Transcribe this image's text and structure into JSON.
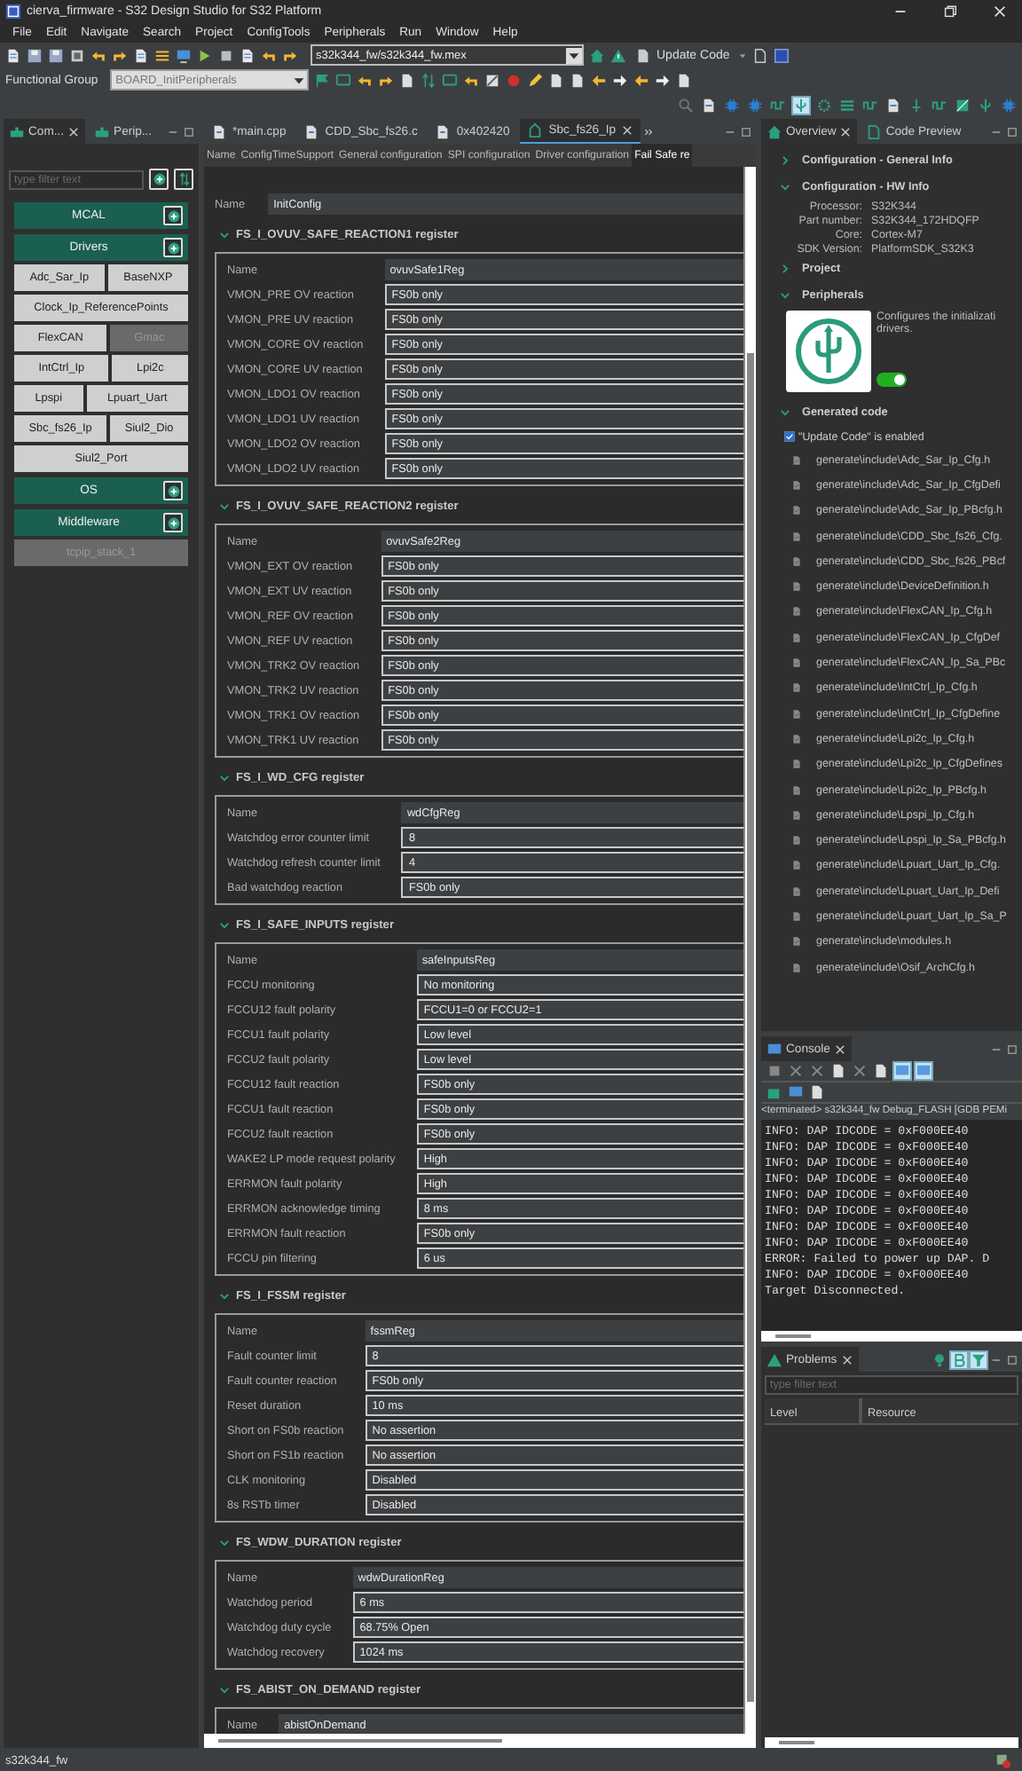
{
  "window": {
    "title": "cierva_firmware - S32 Design Studio for S32 Platform"
  },
  "menu": [
    "File",
    "Edit",
    "Navigate",
    "Search",
    "Project",
    "ConfigTools",
    "Peripherals",
    "Run",
    "Window",
    "Help"
  ],
  "toolbar": {
    "config_file": "s32k344_fw/s32k344_fw.mex",
    "update_code": "Update Code",
    "functional_group_label": "Functional Group",
    "functional_group": {
      "value": "BOARD_InitPeripherals",
      "disabled": true
    }
  },
  "left_panel": {
    "tabs": [
      {
        "label": "Com...",
        "selected": true
      },
      {
        "label": "Perip...",
        "selected": false
      }
    ],
    "filter_placeholder": "type filter text",
    "groups": [
      {
        "name": "MCAL"
      },
      {
        "name": "Drivers",
        "rows": [
          [
            {
              "name": "Adc_Sar_Ip",
              "disabled": false
            },
            {
              "name": "BaseNXP",
              "disabled": false
            }
          ],
          [
            {
              "name": "Clock_Ip_ReferencePoints",
              "disabled": false
            }
          ],
          [
            {
              "name": "FlexCAN",
              "disabled": false
            },
            {
              "name": "Gmac",
              "disabled": true
            }
          ],
          [
            {
              "name": "IntCtrl_Ip",
              "disabled": false
            },
            {
              "name": "Lpi2c",
              "disabled": false
            }
          ],
          [
            {
              "name": "Lpspi",
              "disabled": false
            },
            {
              "name": "Lpuart_Uart",
              "disabled": false
            }
          ],
          [
            {
              "name": "Sbc_fs26_Ip",
              "disabled": false
            },
            {
              "name": "Siul2_Dio",
              "disabled": false
            }
          ],
          [
            {
              "name": "Siul2_Port",
              "disabled": false
            }
          ]
        ]
      },
      {
        "name": "OS"
      },
      {
        "name": "Middleware",
        "rows": [
          [
            {
              "name": "tcpip_stack_1",
              "disabled": true
            }
          ]
        ]
      }
    ]
  },
  "editor": {
    "tabs": [
      {
        "label": "*main.cpp",
        "selected": false
      },
      {
        "label": "CDD_Sbc_fs26.c",
        "selected": false
      },
      {
        "label": "0x402420",
        "selected": false
      },
      {
        "label": "Sbc_fs26_Ip",
        "selected": true
      }
    ],
    "config_tabs": [
      {
        "label": "Name",
        "selected": false
      },
      {
        "label": "ConfigTimeSupport",
        "selected": false
      },
      {
        "label": "General configuration",
        "selected": false
      },
      {
        "label": "SPI configuration",
        "selected": false
      },
      {
        "label": "Driver configuration",
        "selected": false
      },
      {
        "label": "Fail Safe re",
        "selected": true
      }
    ],
    "name_field": {
      "label": "Name",
      "value": "InitConfig"
    },
    "sections": [
      {
        "title": "FS_I_OVUV_SAFE_REACTION1 register",
        "expanded": true,
        "fields": [
          {
            "label": "Name",
            "value": "ovuvSafe1Reg",
            "kind": "name"
          },
          {
            "label": "VMON_PRE OV reaction",
            "value": "FS0b only",
            "kind": "setting"
          },
          {
            "label": "VMON_PRE UV reaction",
            "value": "FS0b only",
            "kind": "setting"
          },
          {
            "label": "VMON_CORE OV reaction",
            "value": "FS0b only",
            "kind": "setting"
          },
          {
            "label": "VMON_CORE UV reaction",
            "value": "FS0b only",
            "kind": "setting"
          },
          {
            "label": "VMON_LDO1 OV reaction",
            "value": "FS0b only",
            "kind": "setting"
          },
          {
            "label": "VMON_LDO1 UV reaction",
            "value": "FS0b only",
            "kind": "setting"
          },
          {
            "label": "VMON_LDO2 OV reaction",
            "value": "FS0b only",
            "kind": "setting"
          },
          {
            "label": "VMON_LDO2 UV reaction",
            "value": "FS0b only",
            "kind": "setting"
          }
        ]
      },
      {
        "title": "FS_I_OVUV_SAFE_REACTION2 register",
        "expanded": true,
        "fields": [
          {
            "label": "Name",
            "value": "ovuvSafe2Reg",
            "kind": "name"
          },
          {
            "label": "VMON_EXT OV reaction",
            "value": "FS0b only",
            "kind": "setting"
          },
          {
            "label": "VMON_EXT UV reaction",
            "value": "FS0b only",
            "kind": "setting"
          },
          {
            "label": "VMON_REF OV reaction",
            "value": "FS0b only",
            "kind": "setting"
          },
          {
            "label": "VMON_REF UV reaction",
            "value": "FS0b only",
            "kind": "setting"
          },
          {
            "label": "VMON_TRK2 OV reaction",
            "value": "FS0b only",
            "kind": "setting"
          },
          {
            "label": "VMON_TRK2 UV reaction",
            "value": "FS0b only",
            "kind": "setting"
          },
          {
            "label": "VMON_TRK1 OV reaction",
            "value": "FS0b only",
            "kind": "setting"
          },
          {
            "label": "VMON_TRK1 UV reaction",
            "value": "FS0b only",
            "kind": "setting"
          }
        ]
      },
      {
        "title": "FS_I_WD_CFG register",
        "expanded": true,
        "fields": [
          {
            "label": "Name",
            "value": "wdCfgReg",
            "kind": "name"
          },
          {
            "label": "Watchdog error counter limit",
            "value": "8",
            "kind": "setting"
          },
          {
            "label": "Watchdog refresh counter limit",
            "value": "4",
            "kind": "setting"
          },
          {
            "label": "Bad watchdog reaction",
            "value": "FS0b only",
            "kind": "setting"
          }
        ]
      },
      {
        "title": "FS_I_SAFE_INPUTS register",
        "expanded": true,
        "fields": [
          {
            "label": "Name",
            "value": "safeInputsReg",
            "kind": "name"
          },
          {
            "label": "FCCU monitoring",
            "value": "No monitoring",
            "kind": "setting"
          },
          {
            "label": "FCCU12 fault polarity",
            "value": "FCCU1=0 or FCCU2=1",
            "kind": "setting"
          },
          {
            "label": "FCCU1 fault polarity",
            "value": "Low level",
            "kind": "setting"
          },
          {
            "label": "FCCU2 fault polarity",
            "value": "Low level",
            "kind": "setting"
          },
          {
            "label": "FCCU12 fault reaction",
            "value": "FS0b only",
            "kind": "setting"
          },
          {
            "label": "FCCU1 fault reaction",
            "value": "FS0b only",
            "kind": "setting"
          },
          {
            "label": "FCCU2 fault reaction",
            "value": "FS0b only",
            "kind": "setting"
          },
          {
            "label": "WAKE2 LP mode request polarity",
            "value": "High",
            "kind": "setting"
          },
          {
            "label": "ERRMON fault polarity",
            "value": "High",
            "kind": "setting"
          },
          {
            "label": "ERRMON acknowledge timing",
            "value": "8 ms",
            "kind": "setting"
          },
          {
            "label": "ERRMON fault reaction",
            "value": "FS0b only",
            "kind": "setting"
          },
          {
            "label": "FCCU pin filtering",
            "value": "6 us",
            "kind": "setting"
          }
        ]
      },
      {
        "title": "FS_I_FSSM register",
        "expanded": true,
        "fields": [
          {
            "label": "Name",
            "value": "fssmReg",
            "kind": "name"
          },
          {
            "label": "Fault counter limit",
            "value": "8",
            "kind": "setting"
          },
          {
            "label": "Fault counter reaction",
            "value": "FS0b only",
            "kind": "setting"
          },
          {
            "label": "Reset duration",
            "value": "10 ms",
            "kind": "setting"
          },
          {
            "label": "Short on FS0b reaction",
            "value": "No assertion",
            "kind": "setting"
          },
          {
            "label": "Short on FS1b reaction",
            "value": "No assertion",
            "kind": "setting"
          },
          {
            "label": "CLK monitoring",
            "value": "Disabled",
            "kind": "setting"
          },
          {
            "label": "8s RSTb timer",
            "value": "Disabled",
            "kind": "setting"
          }
        ]
      },
      {
        "title": "FS_WDW_DURATION register",
        "expanded": true,
        "fields": [
          {
            "label": "Name",
            "value": "wdwDurationReg",
            "kind": "name"
          },
          {
            "label": "Watchdog period",
            "value": "6 ms",
            "kind": "setting"
          },
          {
            "label": "Watchdog duty cycle",
            "value": "68.75% Open",
            "kind": "setting"
          },
          {
            "label": "Watchdog recovery",
            "value": "1024 ms",
            "kind": "setting"
          }
        ]
      },
      {
        "title": "FS_ABIST_ON_DEMAND register",
        "expanded": true,
        "fields": [
          {
            "label": "Name",
            "value": "abistOnDemand",
            "kind": "name"
          }
        ]
      }
    ]
  },
  "overview": {
    "tabs": [
      {
        "label": "Overview",
        "selected": true
      },
      {
        "label": "Code Preview",
        "selected": false
      }
    ],
    "general_info": {
      "title": "Configuration - General Info",
      "expanded": false
    },
    "hw_info": {
      "title": "Configuration - HW Info",
      "expanded": true,
      "props": [
        {
          "label": "Processor:",
          "value": "S32K344"
        },
        {
          "label": "Part number:",
          "value": "S32K344_172HDQFP"
        },
        {
          "label": "Core:",
          "value": "Cortex-M7"
        },
        {
          "label": "SDK Version:",
          "value": "PlatformSDK_S32K3"
        }
      ]
    },
    "project": {
      "title": "Project",
      "expanded": false
    },
    "peripherals": {
      "title": "Peripherals",
      "expanded": true,
      "description": [
        "Configures the initializati",
        "drivers."
      ],
      "enabled": true
    },
    "generated_code": {
      "title": "Generated code",
      "expanded": true,
      "update_enabled": {
        "label": "\"Update Code\" is enabled",
        "checked": true
      },
      "files": [
        "generate\\include\\Adc_Sar_Ip_Cfg.h",
        "generate\\include\\Adc_Sar_Ip_CfgDefi",
        "generate\\include\\Adc_Sar_Ip_PBcfg.h",
        "generate\\include\\CDD_Sbc_fs26_Cfg.",
        "generate\\include\\CDD_Sbc_fs26_PBcf",
        "generate\\include\\DeviceDefinition.h",
        "generate\\include\\FlexCAN_Ip_Cfg.h",
        "generate\\include\\FlexCAN_Ip_CfgDef",
        "generate\\include\\FlexCAN_Ip_Sa_PBc",
        "generate\\include\\IntCtrl_Ip_Cfg.h",
        "generate\\include\\IntCtrl_Ip_CfgDefine",
        "generate\\include\\Lpi2c_Ip_Cfg.h",
        "generate\\include\\Lpi2c_Ip_CfgDefines",
        "generate\\include\\Lpi2c_Ip_PBcfg.h",
        "generate\\include\\Lpspi_Ip_Cfg.h",
        "generate\\include\\Lpspi_Ip_Sa_PBcfg.h",
        "generate\\include\\Lpuart_Uart_Ip_Cfg.",
        "generate\\include\\Lpuart_Uart_Ip_Defi",
        "generate\\include\\Lpuart_Uart_Ip_Sa_P",
        "generate\\include\\modules.h",
        "generate\\include\\Osif_ArchCfg.h"
      ]
    }
  },
  "console": {
    "tab": "Console",
    "header": "<terminated> s32k344_fw Debug_FLASH [GDB PEMi",
    "lines": [
      "INFO: DAP IDCODE = 0xF000EE40",
      "INFO: DAP IDCODE = 0xF000EE40",
      "INFO: DAP IDCODE = 0xF000EE40",
      "INFO: DAP IDCODE = 0xF000EE40",
      "INFO: DAP IDCODE = 0xF000EE40",
      "INFO: DAP IDCODE = 0xF000EE40",
      "INFO: DAP IDCODE = 0xF000EE40",
      "INFO: DAP IDCODE = 0xF000EE40",
      "ERROR: Failed to power up DAP. D",
      "INFO: DAP IDCODE = 0xF000EE40",
      "Target Disconnected."
    ]
  },
  "problems": {
    "tab": "Problems",
    "filter_placeholder": "type filter text",
    "columns": [
      "Level",
      "Resource"
    ]
  },
  "status_bar": {
    "text": "s32k344_fw"
  }
}
